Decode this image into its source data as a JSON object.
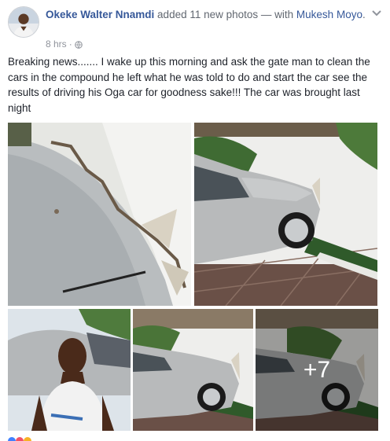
{
  "post": {
    "author": "Okeke Walter Nnamdi",
    "action": " added 11 new photos — with ",
    "tagged": "Mukesh Moyo",
    "tagged_suffix": ".",
    "time": "8 hrs",
    "separator": "·",
    "privacy_icon": "globe-icon",
    "menu_icon": "chevron-down-icon",
    "body": "Breaking news....... I wake up this morning and ask the gate man to clean the cars in the compound he left what he was told to do and start the car see the results of driving his Oga car for goodness sake!!! The car was brought last night",
    "more_photos": "+7"
  },
  "colors": {
    "link": "#365899",
    "meta": "#90949c",
    "text": "#1d2129"
  }
}
